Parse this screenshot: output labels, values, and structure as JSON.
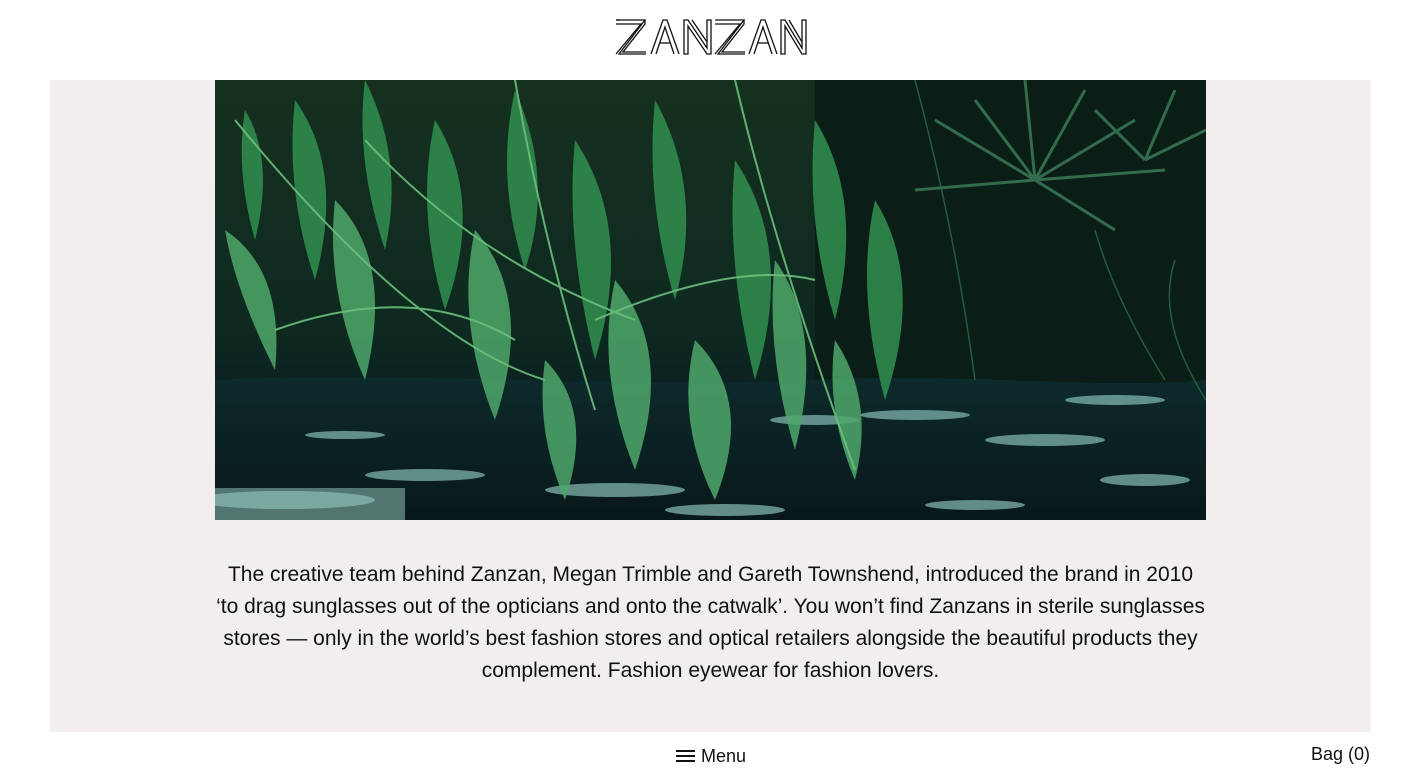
{
  "brand": {
    "logo_text": "ZANZAN"
  },
  "hero": {
    "image_icon": "jungle-river-photo-icon"
  },
  "intro": {
    "text": "The creative team behind Zanzan, Megan Trimble and Gareth Townshend, introduced the brand in 2010 ‘to drag sunglasses out of the opticians and onto the catwalk’. You won’t find Zanzans in sterile sunglasses stores — only in the world’s best fashion stores and optical retailers alongside the beautiful products they complement. Fashion eyewear for fashion lovers."
  },
  "footer": {
    "menu_icon": "hamburger-icon",
    "menu_label": "Menu",
    "bag_label": "Bag (0)"
  },
  "colors": {
    "panel_background": "#f2eeee",
    "text": "#111111"
  }
}
